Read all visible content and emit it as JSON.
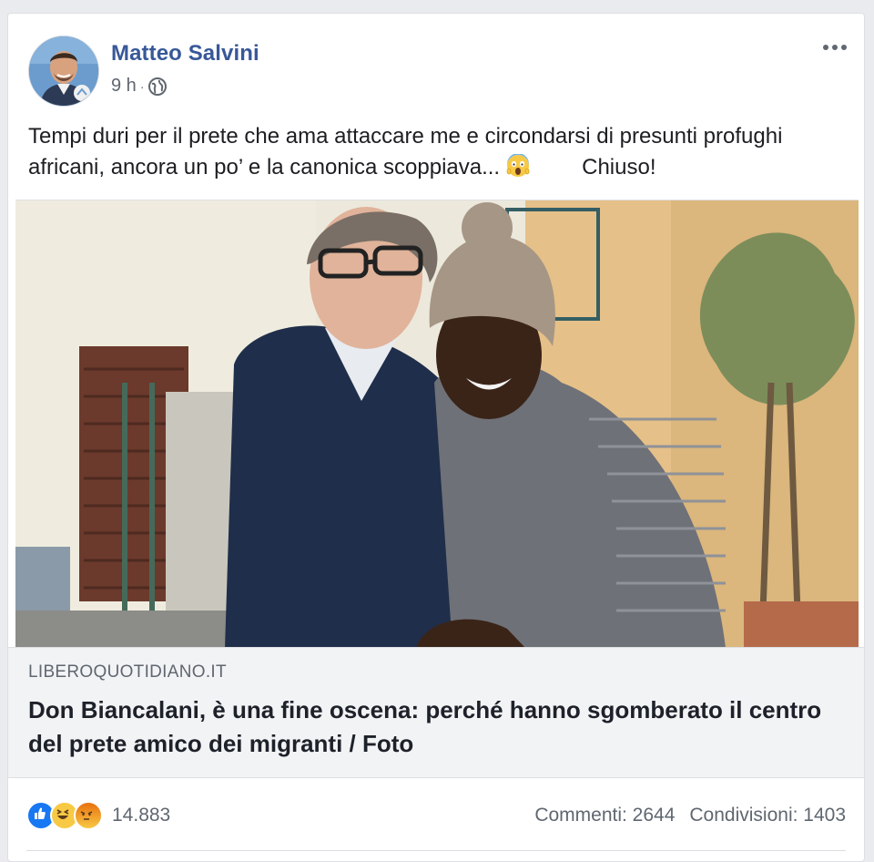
{
  "post": {
    "author": "Matteo Salvini",
    "time": "9 h",
    "separator": "·",
    "text_part1": "Tempi duri per il prete che ama attaccare me e circondarsi di presunti profughi africani, ancora un po’ e la canonica scoppiava...",
    "text_part2": "Chiuso!"
  },
  "link": {
    "domain": "LIBEROQUOTIDIANO.IT",
    "headline": "Don Biancalani, è una fine oscena: perché hanno sgomberato il centro del prete amico dei migranti / Foto"
  },
  "stats": {
    "reactions_count": "14.883",
    "comments": "Commenti: 2644",
    "shares": "Condivisioni: 1403"
  },
  "icons": {
    "privacy": "globe-icon",
    "more": "more-options-icon",
    "reactions": [
      "like-icon",
      "haha-icon",
      "angry-icon"
    ],
    "emoji": "screaming-face-icon"
  },
  "colors": {
    "author_link": "#385898",
    "like_blue": "#1877f2",
    "reaction_yellow": "#f7c944",
    "angry_red": "#e9710f"
  }
}
